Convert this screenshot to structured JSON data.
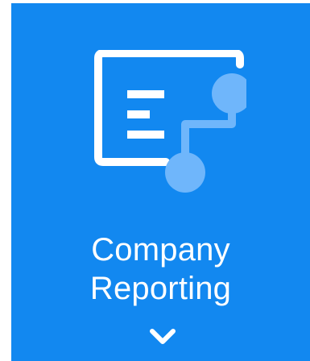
{
  "tile": {
    "label_line1": "Company",
    "label_line2": "Reporting",
    "icon": "report-flow-icon",
    "expand_icon": "chevron-down-icon",
    "colors": {
      "background": "#1288f0",
      "foreground": "#ffffff",
      "node": "#6fb6fb"
    }
  }
}
